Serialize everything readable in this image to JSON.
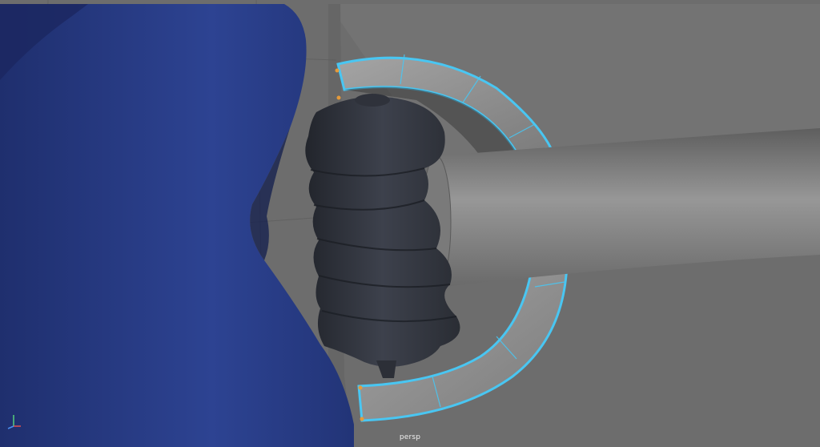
{
  "viewport": {
    "camera_name": "persp",
    "background_color": "#6e6e6e"
  },
  "toolbar": {
    "icons": [
      "tool-icon",
      "tool-icon",
      "tool-icon",
      "tool-icon",
      "tool-icon",
      "tool-icon",
      "tool-icon",
      "tool-icon",
      "tool-icon",
      "tool-icon"
    ]
  },
  "colors": {
    "selection_highlight": "#49c6f2",
    "mesh_blue": "#2a3e86",
    "mesh_dark": "#33363f",
    "mesh_gray": "#8a8a8a",
    "vertex_orange": "#e59a3a"
  },
  "axis_gizmo": {
    "x_label": "x",
    "y_label": "y",
    "z_label": "z"
  }
}
